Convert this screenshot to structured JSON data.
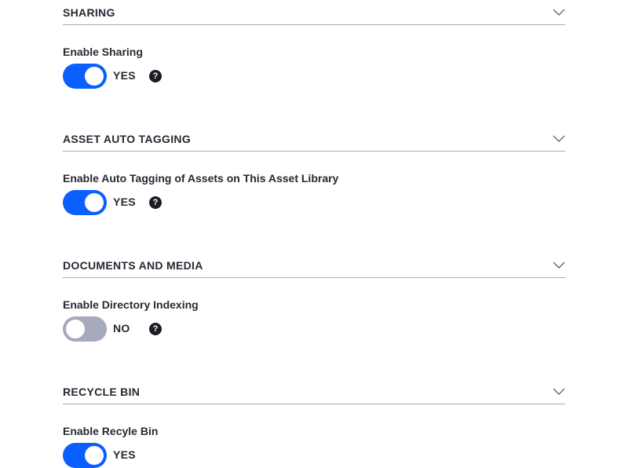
{
  "sections": [
    {
      "title": "SHARING",
      "field_label": "Enable Sharing",
      "toggle_state": "on",
      "toggle_text": "YES",
      "has_help": true
    },
    {
      "title": "ASSET AUTO TAGGING",
      "field_label": "Enable Auto Tagging of Assets on This Asset Library",
      "toggle_state": "on",
      "toggle_text": "YES",
      "has_help": true
    },
    {
      "title": "DOCUMENTS AND MEDIA",
      "field_label": "Enable Directory Indexing",
      "toggle_state": "off",
      "toggle_text": "NO",
      "has_help": true
    },
    {
      "title": "RECYCLE BIN",
      "field_label": "Enable Recyle Bin",
      "toggle_state": "on",
      "toggle_text": "YES",
      "has_help": false
    }
  ],
  "icons": {
    "chevron": "chevron-down-icon",
    "help": "question-circle-icon",
    "help_glyph": "?"
  },
  "colors": {
    "toggle_on": "#0b5fff",
    "toggle_off": "#a7a9bc",
    "divider": "#a7a9bc",
    "text": "#272833"
  }
}
